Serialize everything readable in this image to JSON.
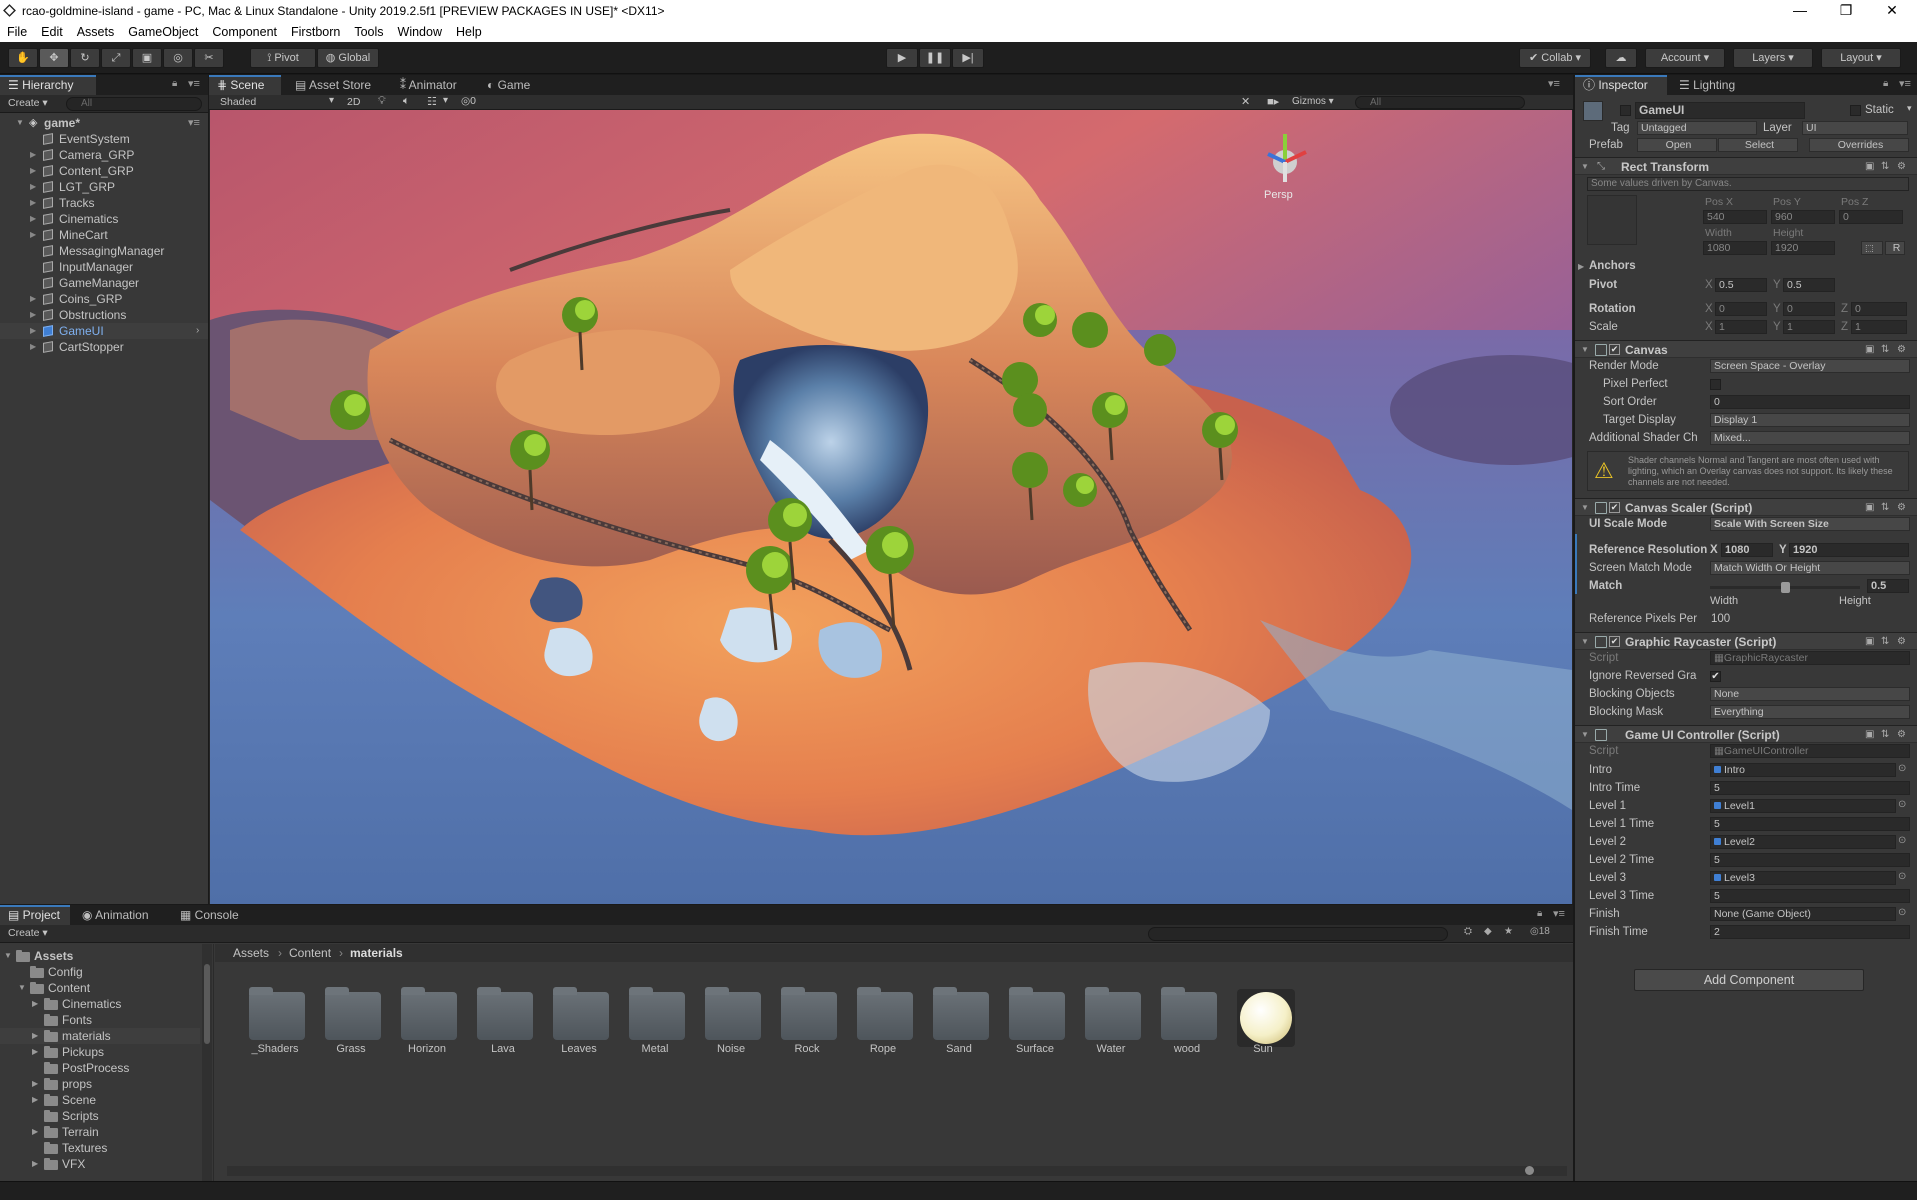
{
  "window": {
    "title": "rcao-goldmine-island - game - PC, Mac & Linux Standalone - Unity 2019.2.5f1 [PREVIEW PACKAGES IN USE]* <DX11>"
  },
  "menu": [
    "File",
    "Edit",
    "Assets",
    "GameObject",
    "Component",
    "Firstborn",
    "Tools",
    "Window",
    "Help"
  ],
  "toolbar": {
    "pivot": "Pivot",
    "global": "Global",
    "collab": "Collab",
    "account": "Account",
    "layers": "Layers",
    "layout": "Layout"
  },
  "hierarchy": {
    "tab": "Hierarchy",
    "create": "Create",
    "search_placeholder": "All",
    "root": "game*",
    "items": [
      "EventSystem",
      "Camera_GRP",
      "Content_GRP",
      "LGT_GRP",
      "Tracks",
      "Cinematics",
      "MineCart",
      "MessagingManager",
      "InputManager",
      "GameManager",
      "Coins_GRP",
      "Obstructions",
      "GameUI",
      "CartStopper"
    ],
    "selected": "GameUI"
  },
  "scene": {
    "tabs": [
      "Scene",
      "Asset Store",
      "Animator",
      "Game"
    ],
    "shading": "Shaded",
    "mode_2d": "2D",
    "fx_count": "0",
    "gizmos": "Gizmos",
    "search_placeholder": "All",
    "persp": "Persp"
  },
  "inspector": {
    "tabs": [
      "Inspector",
      "Lighting"
    ],
    "object_name": "GameUI",
    "static": "Static",
    "tag_label": "Tag",
    "tag": "Untagged",
    "layer_label": "Layer",
    "layer": "UI",
    "prefab_label": "Prefab",
    "open": "Open",
    "select": "Select",
    "overrides": "Overrides",
    "rect_transform": {
      "title": "Rect Transform",
      "note": "Some values driven by Canvas.",
      "pos_x_label": "Pos X",
      "pos_y_label": "Pos Y",
      "pos_z_label": "Pos Z",
      "pos_x": "540",
      "pos_y": "960",
      "pos_z": "0",
      "width_label": "Width",
      "height_label": "Height",
      "width": "1080",
      "height": "1920",
      "anchors": "Anchors",
      "pivot": "Pivot",
      "pivot_x": "0.5",
      "pivot_y": "0.5",
      "rotation": "Rotation",
      "rot_x": "0",
      "rot_y": "0",
      "rot_z": "0",
      "scale": "Scale",
      "scale_x": "1",
      "scale_y": "1",
      "scale_z": "1",
      "x": "X",
      "y": "Y",
      "z": "Z",
      "r": "R"
    },
    "canvas": {
      "title": "Canvas",
      "render_mode_label": "Render Mode",
      "render_mode": "Screen Space - Overlay",
      "pixel_perfect_label": "Pixel Perfect",
      "sort_order_label": "Sort Order",
      "sort_order": "0",
      "target_display_label": "Target Display",
      "target_display": "Display 1",
      "shader_ch_label": "Additional Shader Ch",
      "shader_ch": "Mixed...",
      "warning": "Shader channels Normal and Tangent are most often used with lighting, which an Overlay canvas does not support. Its likely these channels are not needed."
    },
    "canvas_scaler": {
      "title": "Canvas Scaler (Script)",
      "ui_scale_mode_label": "UI Scale Mode",
      "ui_scale_mode": "Scale With Screen Size",
      "ref_res_label": "Reference Resolution",
      "ref_x": "1080",
      "ref_y": "1920",
      "match_mode_label": "Screen Match Mode",
      "match_mode": "Match Width Or Height",
      "match_label": "Match",
      "match_value": "0.5",
      "match_fraction": 0.5,
      "width_label": "Width",
      "height_label": "Height",
      "ref_pixels_label": "Reference Pixels Per",
      "ref_pixels": "100"
    },
    "raycaster": {
      "title": "Graphic Raycaster (Script)",
      "script_label": "Script",
      "script": "GraphicRaycaster",
      "ignore_label": "Ignore Reversed Gra",
      "blocking_objects_label": "Blocking Objects",
      "blocking_objects": "None",
      "blocking_mask_label": "Blocking Mask",
      "blocking_mask": "Everything"
    },
    "controller": {
      "title": "Game UI Controller (Script)",
      "script_label": "Script",
      "script": "GameUIController",
      "rows": [
        {
          "label": "Intro",
          "value": "Intro",
          "obj": true
        },
        {
          "label": "Intro Time",
          "value": "5",
          "obj": false
        },
        {
          "label": "Level 1",
          "value": "Level1",
          "obj": true
        },
        {
          "label": "Level 1 Time",
          "value": "5",
          "obj": false
        },
        {
          "label": "Level 2",
          "value": "Level2",
          "obj": true
        },
        {
          "label": "Level 2 Time",
          "value": "5",
          "obj": false
        },
        {
          "label": "Level 3",
          "value": "Level3",
          "obj": true
        },
        {
          "label": "Level 3 Time",
          "value": "5",
          "obj": false
        },
        {
          "label": "Finish",
          "value": "None (Game Object)",
          "obj": false
        },
        {
          "label": "Finish Time",
          "value": "2",
          "obj": false
        }
      ]
    },
    "add_component": "Add Component"
  },
  "project": {
    "tabs": [
      "Project",
      "Animation",
      "Console"
    ],
    "create": "Create",
    "tree": [
      {
        "label": "Assets",
        "depth": 0,
        "bold": true,
        "arrow": "down"
      },
      {
        "label": "Config",
        "depth": 1,
        "arrow": ""
      },
      {
        "label": "Content",
        "depth": 1,
        "arrow": "down"
      },
      {
        "label": "Cinematics",
        "depth": 2,
        "arrow": "right"
      },
      {
        "label": "Fonts",
        "depth": 2,
        "arrow": ""
      },
      {
        "label": "materials",
        "depth": 2,
        "arrow": "right",
        "selected": true
      },
      {
        "label": "Pickups",
        "depth": 2,
        "arrow": "right"
      },
      {
        "label": "PostProcess",
        "depth": 2,
        "arrow": ""
      },
      {
        "label": "props",
        "depth": 2,
        "arrow": "right"
      },
      {
        "label": "Scene",
        "depth": 2,
        "arrow": "right"
      },
      {
        "label": "Scripts",
        "depth": 2,
        "arrow": ""
      },
      {
        "label": "Terrain",
        "depth": 2,
        "arrow": "right"
      },
      {
        "label": "Textures",
        "depth": 2,
        "arrow": ""
      },
      {
        "label": "VFX",
        "depth": 2,
        "arrow": "right"
      }
    ],
    "breadcrumb": [
      "Assets",
      "Content",
      "materials"
    ],
    "hidden_count": "18",
    "assets": [
      "_Shaders",
      "Grass",
      "Horizon",
      "Lava",
      "Leaves",
      "Metal",
      "Noise",
      "Rock",
      "Rope",
      "Sand",
      "Surface",
      "Water",
      "wood",
      "Sun"
    ]
  },
  "colors": {
    "accent": "#3a79bb",
    "selected_text": "#7fb0ef",
    "panel": "#383838",
    "toolbar": "#1e1e1e"
  }
}
